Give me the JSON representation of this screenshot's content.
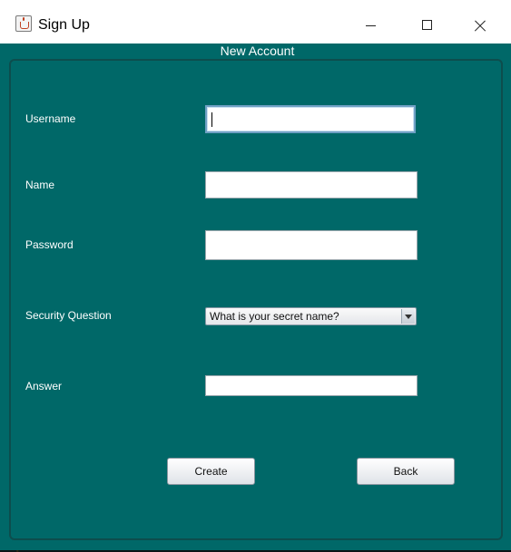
{
  "window": {
    "title": "Sign Up",
    "panel_title": "New Account"
  },
  "form": {
    "username": {
      "label": "Username",
      "value": ""
    },
    "name": {
      "label": "Name",
      "value": ""
    },
    "password": {
      "label": "Password",
      "value": ""
    },
    "security_question": {
      "label": "Security Question",
      "selected": "What is your secret name?"
    },
    "answer": {
      "label": "Answer",
      "value": ""
    }
  },
  "buttons": {
    "create": "Create",
    "back": "Back"
  },
  "icons": {
    "app": "java-cup-icon",
    "minimize": "minimize-icon",
    "maximize": "maximize-icon",
    "close": "close-icon",
    "dropdown": "chevron-down-icon"
  },
  "colors": {
    "panel_background": "#006868",
    "titlebar_background": "#ffffff",
    "text": "#ffffff"
  }
}
